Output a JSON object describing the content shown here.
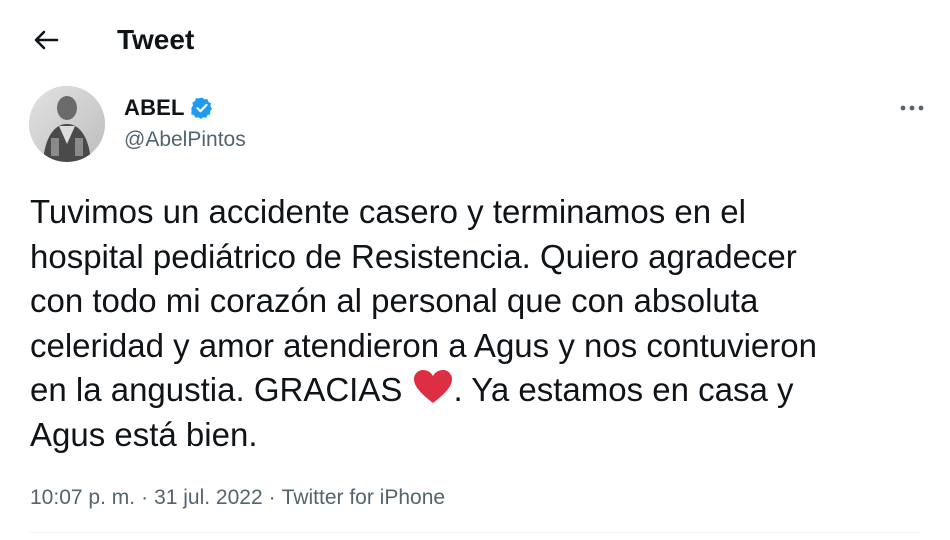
{
  "header": {
    "back_icon": "arrow-left-icon",
    "title": "Tweet"
  },
  "author": {
    "name": "ABEL",
    "handle": "@AbelPintos",
    "verified_icon": "verified-badge-icon",
    "verified_color": "#1d9bf0"
  },
  "more_icon": "more-options-icon",
  "tweet": {
    "lines": [
      "Tuvimos un accidente casero y terminamos en el",
      "hospital pediátrico de Resistencia. Quiero agradecer",
      "con todo mi corazón al personal que con absoluta",
      "celeridad y amor atendieron a Agus y nos contuvieron",
      "en la angustia. GRACIAS ",
      ". Ya estamos en casa y",
      "Agus está bien."
    ],
    "heart_icon": "red-heart-icon",
    "heart_color": "#dd2e44"
  },
  "meta": {
    "time": "10:07 p. m.",
    "separator": "·",
    "date": "31 jul. 2022",
    "source": "Twitter for iPhone"
  },
  "colors": {
    "text": "#0f1419",
    "secondary": "#536471",
    "divider": "#eff3f4"
  }
}
